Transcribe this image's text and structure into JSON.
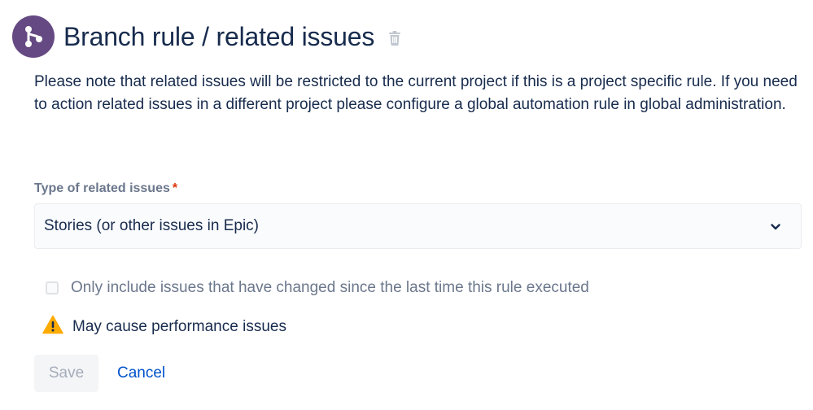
{
  "header": {
    "icon": "branch-icon",
    "icon_bg": "#654982",
    "title": "Branch rule / related issues",
    "delete_icon": "trash-icon"
  },
  "note": "Please note that related issues will be restricted to the current project if this is a project specific rule. If you need to action related issues in a different project please configure a global automation rule in global administration.",
  "field": {
    "label": "Type of related issues",
    "required_marker": "*",
    "selected_value": "Stories (or other issues in Epic)",
    "dropdown_icon": "chevron-down-icon"
  },
  "checkbox": {
    "label": "Only include issues that have changed since the last time this rule executed",
    "checked": false
  },
  "warning": {
    "icon": "warning-icon",
    "text": "May cause performance issues",
    "color": "#ffab00"
  },
  "actions": {
    "save_label": "Save",
    "cancel_label": "Cancel",
    "link_color": "#0052cc"
  }
}
